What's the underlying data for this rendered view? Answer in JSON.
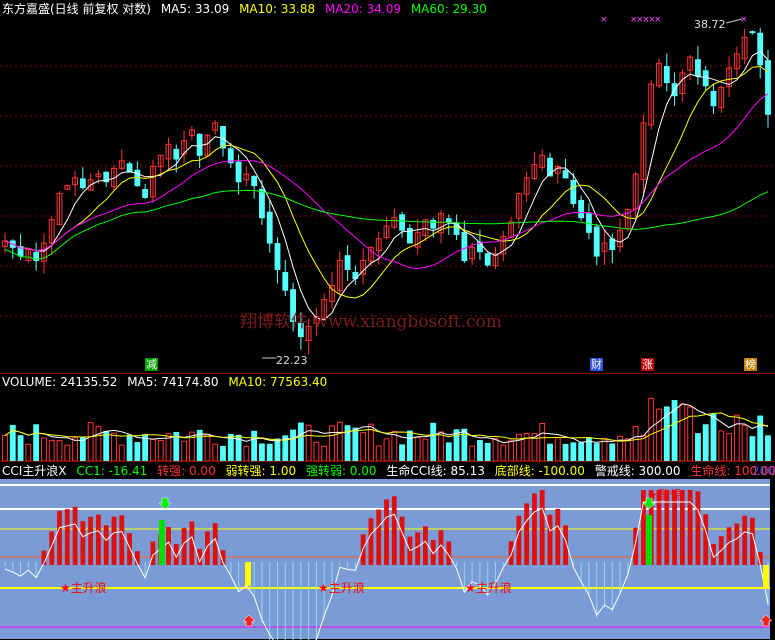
{
  "colors": {
    "bg": "#000000",
    "up": "#ff3232",
    "down": "#54ffff",
    "ma5": "#ffffff",
    "ma10": "#ffff00",
    "ma20": "#ff00ff",
    "ma60": "#00ff00",
    "grid": "#8b0000",
    "cci_bg": "#7a9bd6",
    "white": "#ffffff",
    "yellow": "#ffff00",
    "green": "#00ff00",
    "red": "#ff0000",
    "blue": "#0000ff"
  },
  "price_panel": {
    "stock_name": "东方嘉盛(日线 前复权 对数)",
    "ma5": "MA5: 33.09",
    "ma10": "MA10: 33.88",
    "ma20": "MA20: 34.09",
    "ma60": "MA60: 29.30",
    "high_label": "38.72",
    "low_label": "22.23",
    "event_tags": [
      {
        "text": "减",
        "color": "#00c000"
      },
      {
        "text": "财",
        "color": "#4060ff"
      },
      {
        "text": "涨",
        "color": "#c00000"
      },
      {
        "text": "榜",
        "color": "#c08000"
      }
    ]
  },
  "watermark": "翔博软件 www.xiangbosoft.com",
  "volume_panel": {
    "volume": "VOLUME: 24135.52",
    "ma5": "MA5: 74174.80",
    "ma10": "MA10: 77563.40"
  },
  "cci_panel": {
    "title": "CCI主升浪X",
    "cc1": "CC1: -16.41",
    "qz": "转强: 0.00",
    "rzq": "弱转强: 1.00",
    "qzr": "强转弱: 0.00",
    "life": "生命CCI线: 85.13",
    "bottom": "底部线: -100.00",
    "warn": "警戒线: 300.00",
    "lifeline": "生命线: 100.00",
    "right_value": "200",
    "star_labels": [
      "★主升浪",
      "★主升浪",
      "★主升浪",
      "★警惕"
    ]
  },
  "chart_data": {
    "type": "candlestick",
    "title": "东方嘉盛(日线 前复权 对数)",
    "high": 38.72,
    "low": 22.23,
    "close_series_approx": [
      26.5,
      26.2,
      25.8,
      26.1,
      25.6,
      26.4,
      27.5,
      28.8,
      29.2,
      29.6,
      29.1,
      29.5,
      29.8,
      29.4,
      30.1,
      30.5,
      29.9,
      29.2,
      28.6,
      30.2,
      30.8,
      31.4,
      30.6,
      31.6,
      32.2,
      30.8,
      31.9,
      32.6,
      31.2,
      30.4,
      29.4,
      29.8,
      29.2,
      27.6,
      26.4,
      25.2,
      24.3,
      23.0,
      22.4,
      22.8,
      23.2,
      23.9,
      24.5,
      25.6,
      25.2,
      24.8,
      25.6,
      26.2,
      26.6,
      27.2,
      27.6,
      27.0,
      26.4,
      26.9,
      27.5,
      27.1,
      27.8,
      27.4,
      26.8,
      25.6,
      26.2,
      26.0,
      25.4,
      25.9,
      26.7,
      27.4,
      28.8,
      29.6,
      30.3,
      30.8,
      29.7,
      30.2,
      29.6,
      28.3,
      27.6,
      26.9,
      25.8,
      26.4,
      26.1,
      27.0,
      28.0,
      29.8,
      32.6,
      34.9,
      36.2,
      35.0,
      34.2,
      35.6,
      36.6,
      35.4,
      34.8,
      33.6,
      34.7,
      35.9,
      36.8,
      37.9,
      38.2,
      36.1,
      33.1
    ]
  }
}
